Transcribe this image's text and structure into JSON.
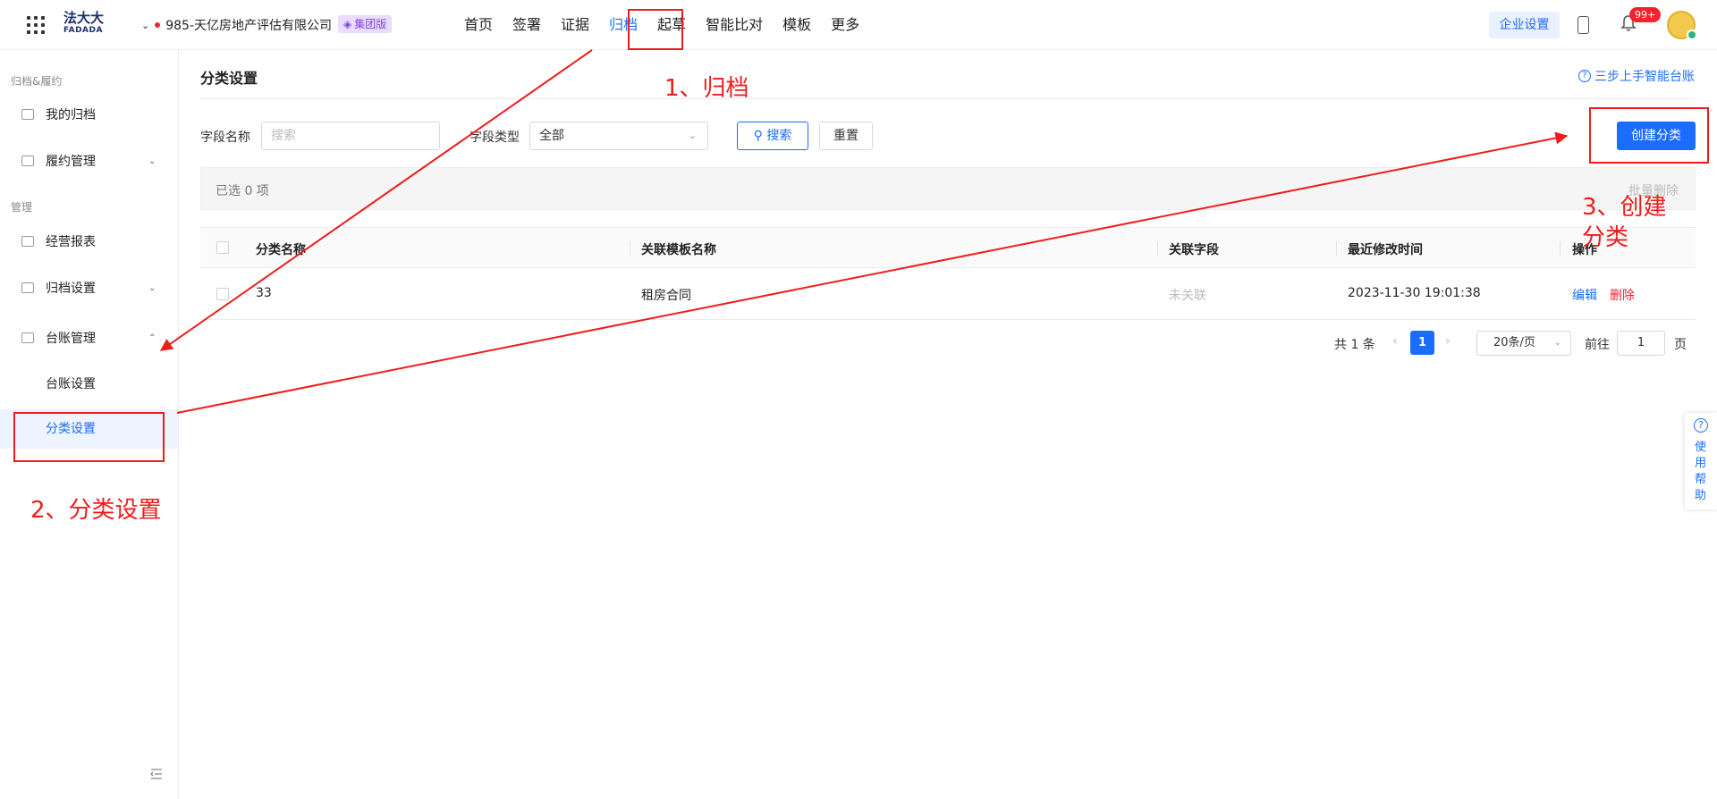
{
  "topbar": {
    "logo_cn": "法大大",
    "logo_en": "FADADA",
    "company": "985-天亿房地产评估有限公司",
    "edition_badge": "集团版",
    "nav": [
      "首页",
      "签署",
      "证据",
      "归档",
      "起草",
      "智能比对",
      "模板",
      "更多"
    ],
    "active_nav": "归档",
    "enterprise_settings": "企业设置",
    "notification_count": "99+"
  },
  "sidebar": {
    "group1": "归档&履约",
    "my_archive": "我的归档",
    "performance": "履约管理",
    "group2": "管理",
    "reports": "经营报表",
    "archive_settings": "归档设置",
    "ledger": "台账管理",
    "ledger_settings": "台账设置",
    "category_settings": "分类设置"
  },
  "main": {
    "title": "分类设置",
    "help_link": "三步上手智能台账",
    "field_name_label": "字段名称",
    "search_placeholder": "搜索",
    "field_type_label": "字段类型",
    "field_type_value": "全部",
    "search_btn": "搜索",
    "reset_btn": "重置",
    "create_btn": "创建分类",
    "selected_count": "已选 0 项",
    "batch_delete": "批量删除",
    "columns": [
      "分类名称",
      "关联模板名称",
      "关联字段",
      "最近修改时间",
      "操作"
    ],
    "rows": [
      {
        "name": "33",
        "template": "租房合同",
        "field": "未关联",
        "modified": "2023-11-30 19:01:38",
        "edit": "编辑",
        "delete": "删除"
      }
    ],
    "pagination": {
      "total": "共 1 条",
      "current_page": "1",
      "page_size": "20条/页",
      "goto_label": "前往",
      "goto_value": "1",
      "page_suffix": "页"
    }
  },
  "help_float": "使用帮助",
  "annotations": {
    "step1": "1、归档",
    "step2": "2、分类设置",
    "step3": "3、创建分类",
    "color": "#f01c1c"
  },
  "colors": {
    "accent": "#1a6dff",
    "danger": "#f5222d"
  }
}
